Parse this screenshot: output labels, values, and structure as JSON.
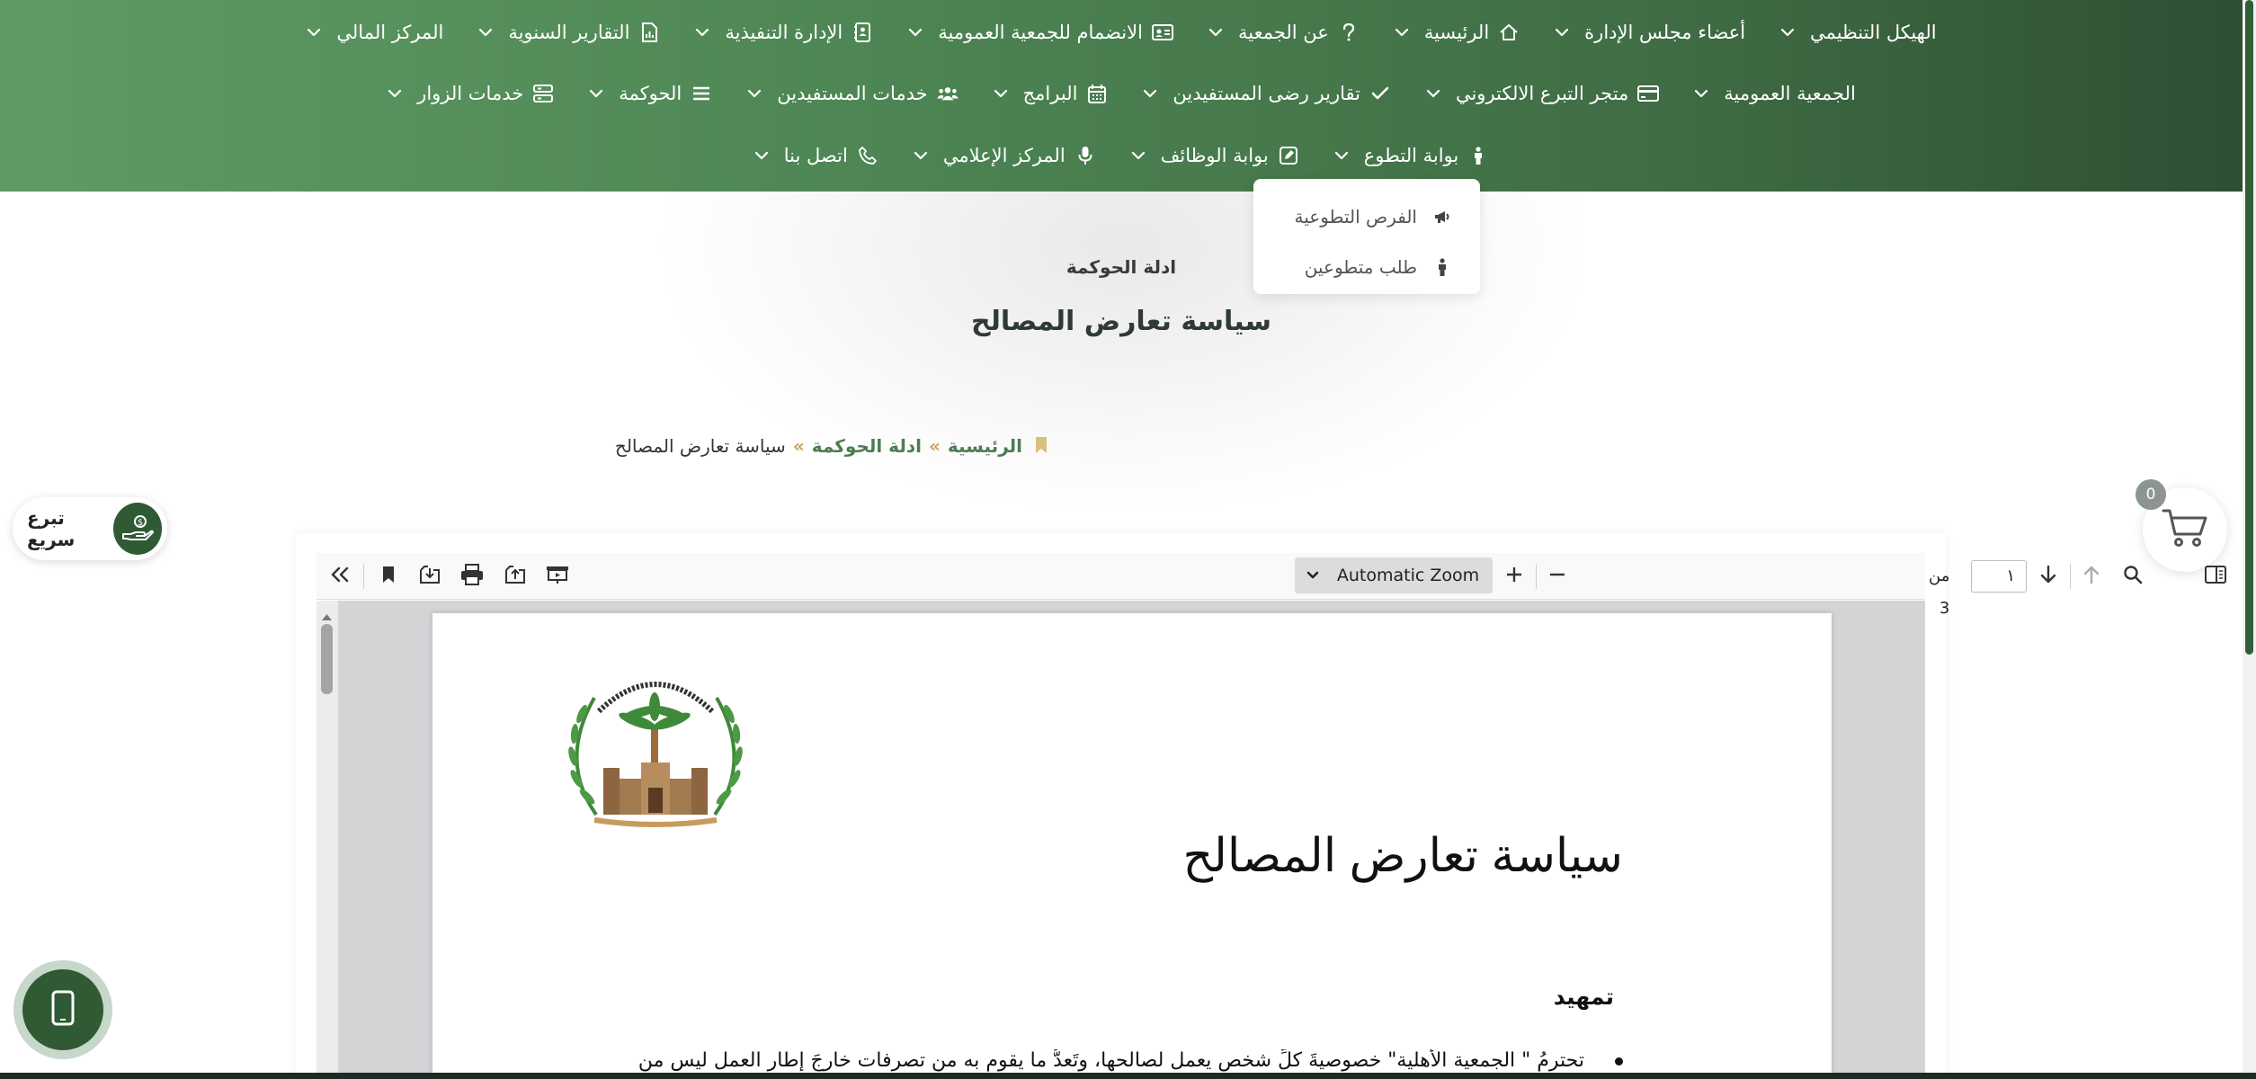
{
  "colors": {
    "nav_green": "#4f8856",
    "dark_green": "#2f5a34",
    "link_green": "#4e7c52",
    "gold": "#c9a35a"
  },
  "nav": {
    "row1": [
      {
        "label": "الهيكل التنظيمي",
        "icon": "none",
        "name": "org-structure"
      },
      {
        "label": "أعضاء مجلس الإدارة",
        "icon": "none",
        "name": "board-members"
      },
      {
        "label": "الرئيسية",
        "icon": "home-icon",
        "name": "home"
      },
      {
        "label": "عن الجمعية",
        "icon": "question-icon",
        "name": "about"
      },
      {
        "label": "الانضمام للجمعية العمومية",
        "icon": "id-card-icon",
        "name": "join-assembly"
      },
      {
        "label": "الإدارة التنفيذية",
        "icon": "contact-book-icon",
        "name": "executive-management"
      },
      {
        "label": "التقارير السنوية",
        "icon": "report-file-icon",
        "name": "annual-reports"
      },
      {
        "label": "المركز المالي",
        "icon": "none",
        "name": "financial-center"
      }
    ],
    "row2": [
      {
        "label": "الجمعية العمومية",
        "icon": "none",
        "name": "general-assembly"
      },
      {
        "label": "متجر التبرع الالكتروني",
        "icon": "credit-card-icon",
        "name": "donation-store"
      },
      {
        "label": "تقارير رضى المستفيدين",
        "icon": "check-icon",
        "name": "satisfaction-reports"
      },
      {
        "label": "البرامج",
        "icon": "calendar-icon",
        "name": "programs"
      },
      {
        "label": "خدمات المستفيدين",
        "icon": "users-icon",
        "name": "beneficiary-services"
      },
      {
        "label": "الحوكمة",
        "icon": "list-icon",
        "name": "governance"
      },
      {
        "label": "خدمات الزوار",
        "icon": "server-icon",
        "name": "visitor-services"
      }
    ],
    "row3": [
      {
        "label": "بوابة التطوع",
        "icon": "person-icon",
        "name": "volunteer-portal"
      },
      {
        "label": "بوابة الوظائف",
        "icon": "edit-square-icon",
        "name": "jobs-portal"
      },
      {
        "label": "المركز الإعلامي",
        "icon": "microphone-icon",
        "name": "media-center"
      },
      {
        "label": "اتصل بنا",
        "icon": "phone-icon",
        "name": "contact-us"
      }
    ]
  },
  "dropdown": {
    "items": [
      {
        "label": "الفرص التطوعية",
        "icon": "megaphone-icon"
      },
      {
        "label": "طلب متطوعين",
        "icon": "person-icon"
      }
    ]
  },
  "hero": {
    "subtitle": "ادلة الحوكمة",
    "title": "سياسة تعارض المصالح"
  },
  "breadcrumb": {
    "home": "الرئيسية",
    "sep": "»",
    "parent": "ادلة الحوكمة",
    "current": "سياسة تعارض المصالح"
  },
  "quick_donate": {
    "label": "تبرع سريع"
  },
  "cart": {
    "count": "0"
  },
  "pdf": {
    "zoom": "Automatic Zoom",
    "page_input": "١",
    "page_of": "من 3",
    "doc_title": "سياسة تعارض المصالح",
    "heading": "تمهيد",
    "paragraph": "تحترمُ \" الجمعية الأهلية\" خصوصيةَ كلِّ شخص يعمل لصالحها، وتَعدُّ ما يقوم به من تصرفات خارجَ إطار العمل ليس من"
  }
}
